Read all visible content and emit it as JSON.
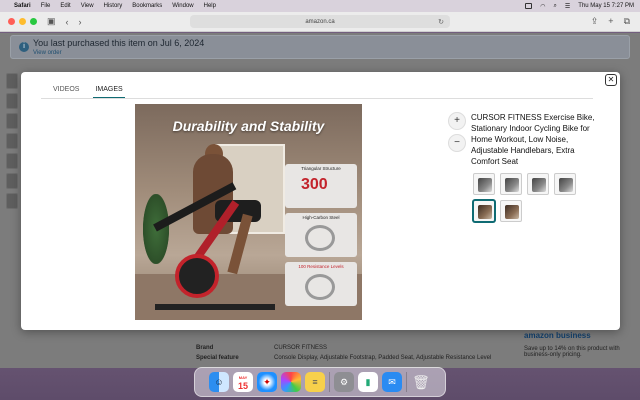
{
  "menubar": {
    "apple": "",
    "items": [
      "Safari",
      "File",
      "Edit",
      "View",
      "History",
      "Bookmarks",
      "Window",
      "Help"
    ],
    "datetime": "Thu May 15  7:27 PM"
  },
  "browser": {
    "url": "amazon.ca"
  },
  "page": {
    "notice_title": "You last purchased this item on Jul 6, 2024",
    "notice_link": "View order",
    "details": [
      {
        "key": "Brand",
        "value": "CURSOR FITNESS"
      },
      {
        "key": "Special feature",
        "value": "Console Display, Adjustable Footstrap, Padded Seat, Adjustable Resistance Level"
      }
    ],
    "business_logo": "amazon business",
    "business_text": "Save up to 14% on this product with business-only pricing."
  },
  "modal": {
    "tabs": [
      "VIDEOS",
      "IMAGES"
    ],
    "active_tab": "IMAGES",
    "close_label": "✕",
    "image": {
      "title": "Durability and Stability",
      "feature_1": "Triangular Structure",
      "feature_1_num": "300",
      "feature_2": "High-Carbon Steel",
      "feature_3": "100 Resistance Levels"
    },
    "zoom_in": "+",
    "zoom_out": "−",
    "product_title": "CURSOR FITNESS Exercise Bike, Stationary Indoor Cycling Bike for Home Workout, Low Noise, Adjustable Handlebars, Extra Comfort Seat",
    "thumbnails": 6,
    "selected_thumbnail": 5
  },
  "dock": {
    "calendar_month": "MAY",
    "calendar_day": "15"
  },
  "colors": {
    "accent": "#0f6b73",
    "brand_red": "#c3232b"
  }
}
